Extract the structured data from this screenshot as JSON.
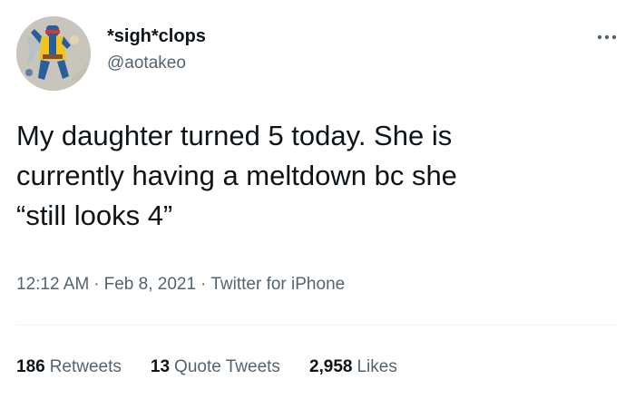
{
  "tweet": {
    "author": {
      "display_name": "*sigh*clops",
      "handle": "@aotakeo",
      "avatar_icon": "cyclops-avatar-icon"
    },
    "more_icon": "more-options-icon",
    "text": "My daughter turned 5 today. She is\ncurrently having a meltdown bc she\n“still looks 4”",
    "time": "12:12 AM",
    "date": "Feb 8, 2021",
    "source": "Twitter for iPhone",
    "separator": "·",
    "stats": {
      "retweets": {
        "count": "186",
        "label": "Retweets"
      },
      "quote_tweets": {
        "count": "13",
        "label": "Quote Tweets"
      },
      "likes": {
        "count": "2,958",
        "label": "Likes"
      }
    },
    "colors": {
      "text_primary": "#0f1419",
      "text_secondary": "#536471",
      "divider": "#eff3f4"
    }
  }
}
